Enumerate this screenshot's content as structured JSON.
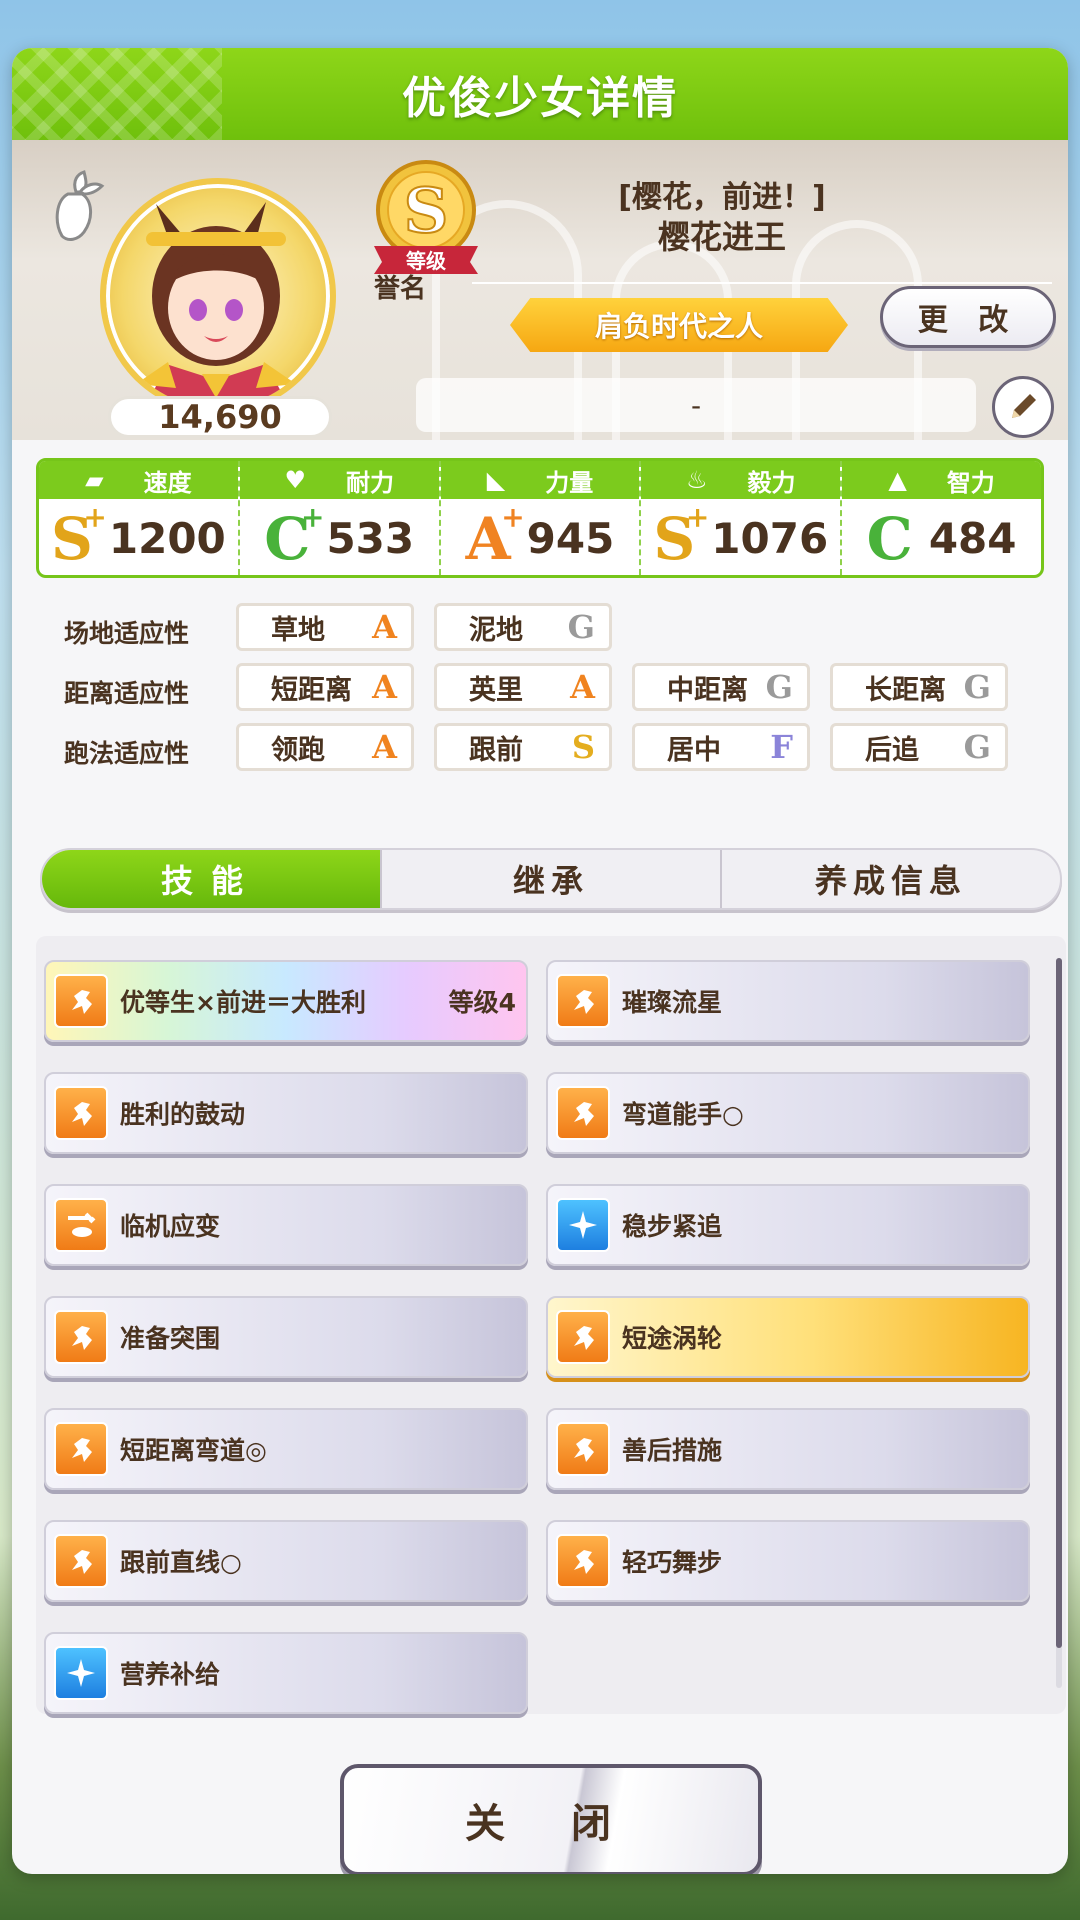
{
  "header": {
    "title": "优俊少女详情"
  },
  "profile": {
    "fans": "14,690",
    "rank": "S",
    "rank_ribbon": "等级",
    "rank_label": "誉名",
    "title_sub": "[樱花，前进！]",
    "name": "樱花进王",
    "epithet": "肩负时代之人",
    "change_label": "更 改",
    "comment": "-"
  },
  "stats": [
    {
      "label": "速度",
      "grade": "S",
      "plus": "+",
      "value": "1200",
      "grade_color": "#e2a41a",
      "icon": "shoe-icon"
    },
    {
      "label": "耐力",
      "grade": "C",
      "plus": "+",
      "value": "533",
      "grade_color": "#49b23a",
      "icon": "heart-icon"
    },
    {
      "label": "力量",
      "grade": "A",
      "plus": "+",
      "value": "945",
      "grade_color": "#f08322",
      "icon": "muscle-icon"
    },
    {
      "label": "毅力",
      "grade": "S",
      "plus": "+",
      "value": "1076",
      "grade_color": "#e2a41a",
      "icon": "flame-icon"
    },
    {
      "label": "智力",
      "grade": "C",
      "plus": "",
      "value": "484",
      "grade_color": "#49b23a",
      "icon": "graduation-cap-icon"
    }
  ],
  "aptitude": {
    "track_label": "场地适应性",
    "distance_label": "距离适应性",
    "style_label": "跑法适应性",
    "track": [
      {
        "name": "草地",
        "grade": "A"
      },
      {
        "name": "泥地",
        "grade": "G"
      }
    ],
    "distance": [
      {
        "name": "短距离",
        "grade": "A"
      },
      {
        "name": "英里",
        "grade": "A"
      },
      {
        "name": "中距离",
        "grade": "G"
      },
      {
        "name": "长距离",
        "grade": "G"
      }
    ],
    "style": [
      {
        "name": "领跑",
        "grade": "A"
      },
      {
        "name": "跟前",
        "grade": "S"
      },
      {
        "name": "居中",
        "grade": "F"
      },
      {
        "name": "后追",
        "grade": "G"
      }
    ]
  },
  "grade_colors": {
    "A": "#f0831f",
    "S": "#e4ad1f",
    "G": "#9a9a9a",
    "F": "#8b84d9"
  },
  "tabs": [
    {
      "label": "技能"
    },
    {
      "label": "继承"
    },
    {
      "label": "养成信息"
    }
  ],
  "skills": [
    {
      "name": "优等生×前进＝大胜利",
      "level": "等级4",
      "style": "rainbow",
      "icon": "runner-icon"
    },
    {
      "name": "璀璨流星",
      "level": "",
      "style": "normal",
      "icon": "runner-icon"
    },
    {
      "name": "胜利的鼓动",
      "level": "",
      "style": "normal",
      "icon": "runner-icon"
    },
    {
      "name": "弯道能手○",
      "level": "",
      "style": "normal",
      "icon": "runner-icon"
    },
    {
      "name": "临机应变",
      "level": "",
      "style": "normal",
      "icon": "swap-icon"
    },
    {
      "name": "稳步紧追",
      "level": "",
      "style": "normal",
      "icon": "sparkle-icon"
    },
    {
      "name": "准备突围",
      "level": "",
      "style": "normal",
      "icon": "runner-icon"
    },
    {
      "name": "短途涡轮",
      "level": "",
      "style": "gold",
      "icon": "runner-icon"
    },
    {
      "name": "短距离弯道◎",
      "level": "",
      "style": "normal",
      "icon": "runner-icon"
    },
    {
      "name": "善后措施",
      "level": "",
      "style": "normal",
      "icon": "runner-icon"
    },
    {
      "name": "跟前直线○",
      "level": "",
      "style": "normal",
      "icon": "runner-icon"
    },
    {
      "name": "轻巧舞步",
      "level": "",
      "style": "normal",
      "icon": "runner-icon"
    },
    {
      "name": "营养补给",
      "level": "",
      "style": "normal",
      "icon": "sparkle-icon"
    }
  ],
  "close_label": "关 闭"
}
